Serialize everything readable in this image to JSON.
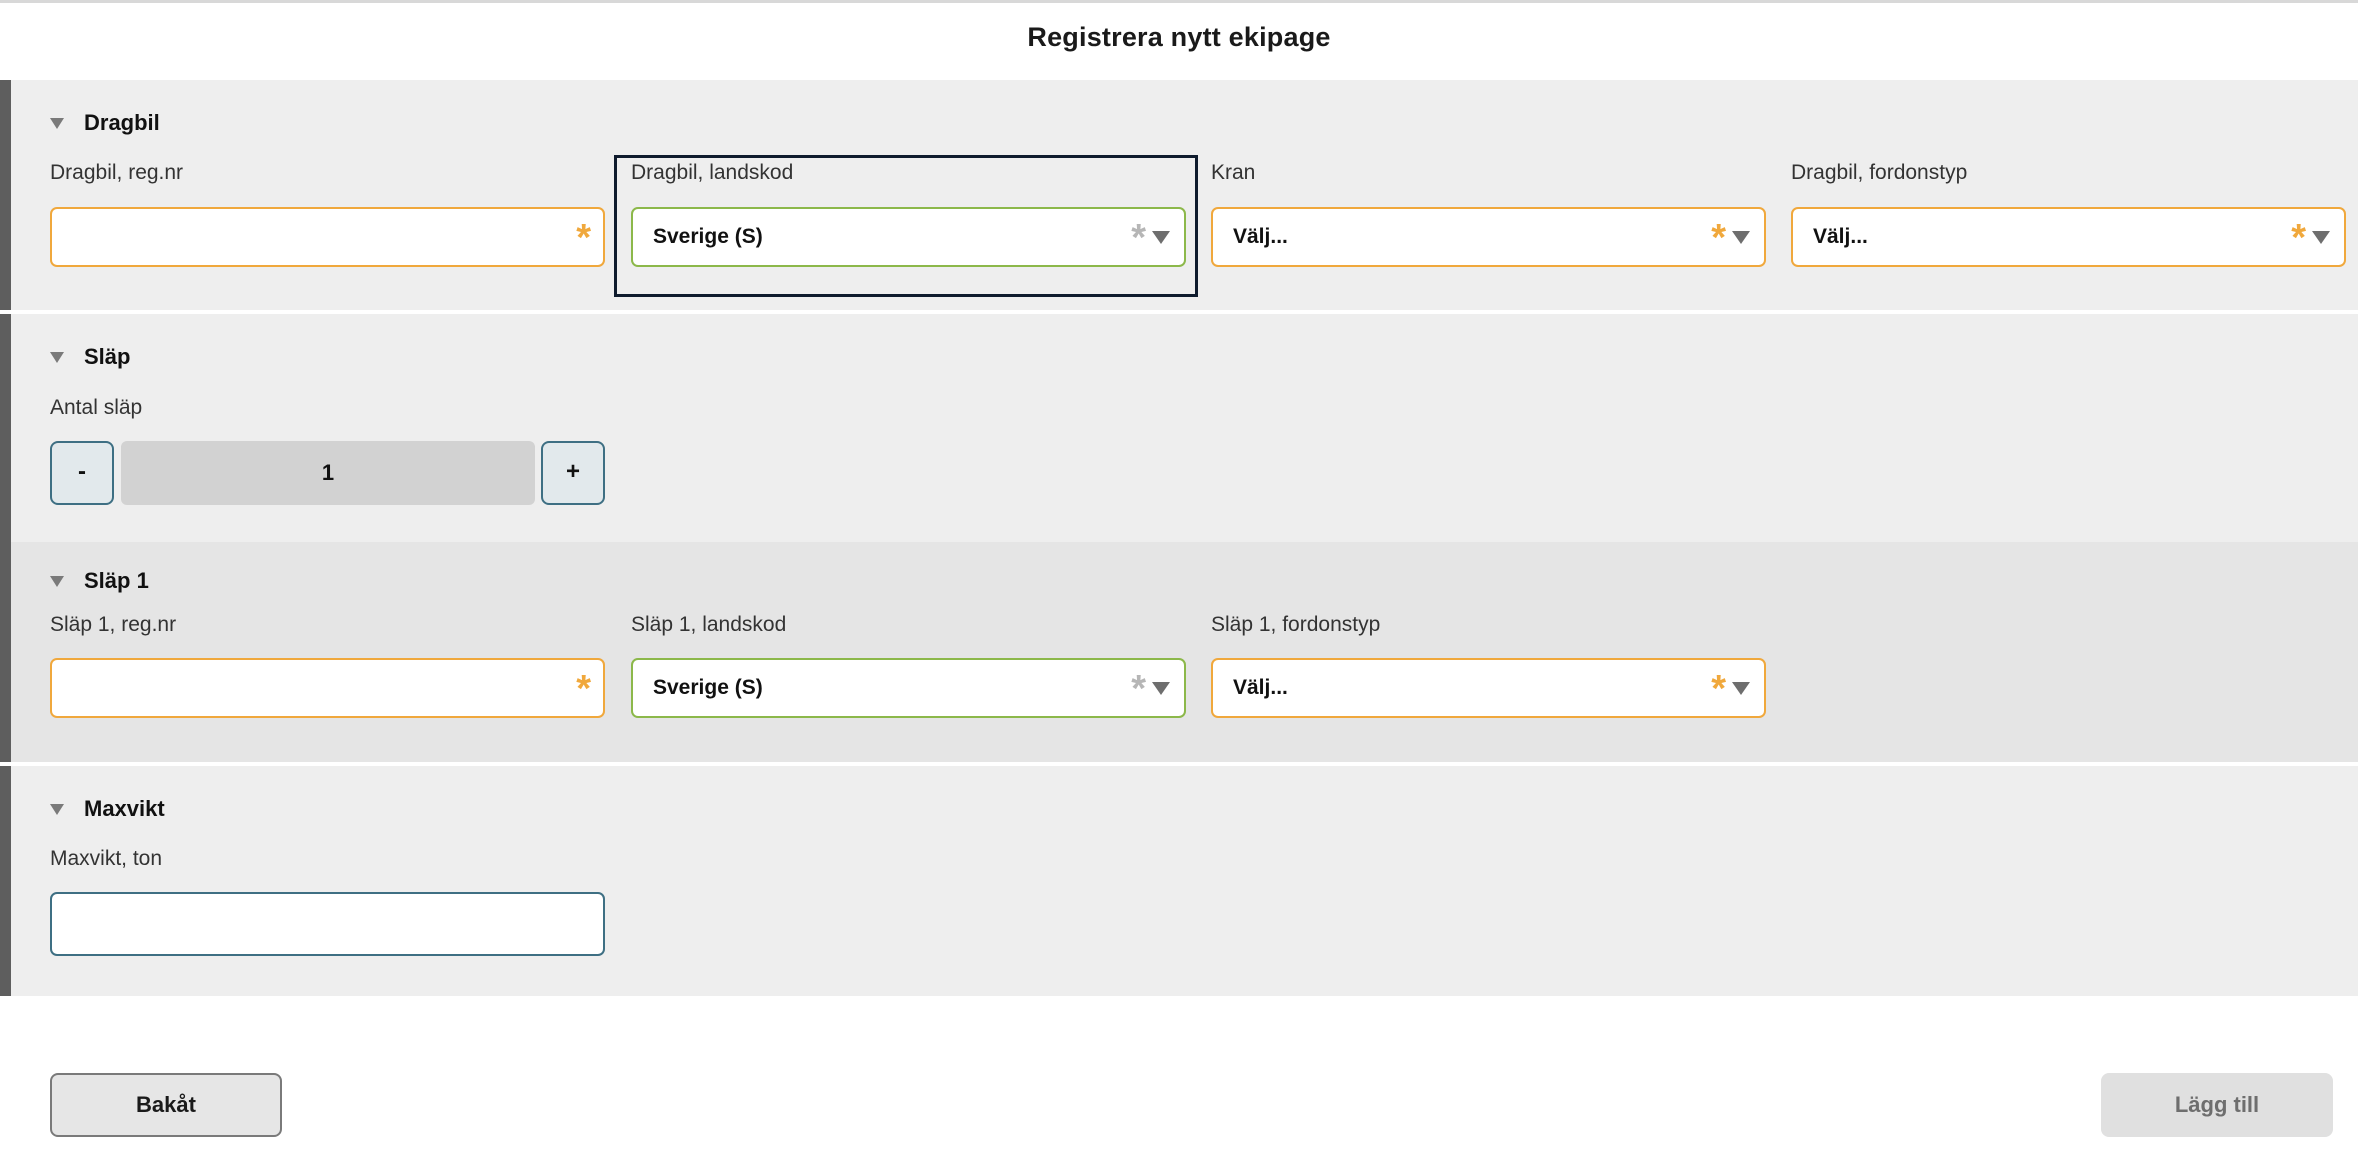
{
  "page": {
    "title": "Registrera nytt ekipage"
  },
  "dragbil": {
    "title": "Dragbil",
    "regnr": {
      "label": "Dragbil, reg.nr",
      "value": "",
      "required_mark": "*"
    },
    "landskod": {
      "label": "Dragbil, landskod",
      "value": "Sverige (S)",
      "required_mark": "*"
    },
    "kran": {
      "label": "Kran",
      "value": "Välj...",
      "required_mark": "*"
    },
    "fordonstyp": {
      "label": "Dragbil, fordonstyp",
      "value": "Välj...",
      "required_mark": "*"
    }
  },
  "slap": {
    "title": "Släp",
    "antal": {
      "label": "Antal släp",
      "minus": "-",
      "value": "1",
      "plus": "+"
    }
  },
  "slap1": {
    "title": "Släp 1",
    "regnr": {
      "label": "Släp 1, reg.nr",
      "value": "",
      "required_mark": "*"
    },
    "landskod": {
      "label": "Släp 1, landskod",
      "value": "Sverige (S)",
      "required_mark": "*"
    },
    "fordonstyp": {
      "label": "Släp 1, fordonstyp",
      "value": "Välj...",
      "required_mark": "*"
    }
  },
  "maxvikt": {
    "title": "Maxvikt",
    "ton": {
      "label": "Maxvikt, ton",
      "value": ""
    }
  },
  "actions": {
    "back": "Bakåt",
    "add": "Lägg till"
  },
  "colors": {
    "required_border": "#f0a83c",
    "valid_border": "#8cb84a",
    "input_border": "#3e6f83",
    "section_bg": "#eeeeee",
    "section_bar": "#5e5e5e",
    "focus_frame": "#0f1b2d"
  }
}
